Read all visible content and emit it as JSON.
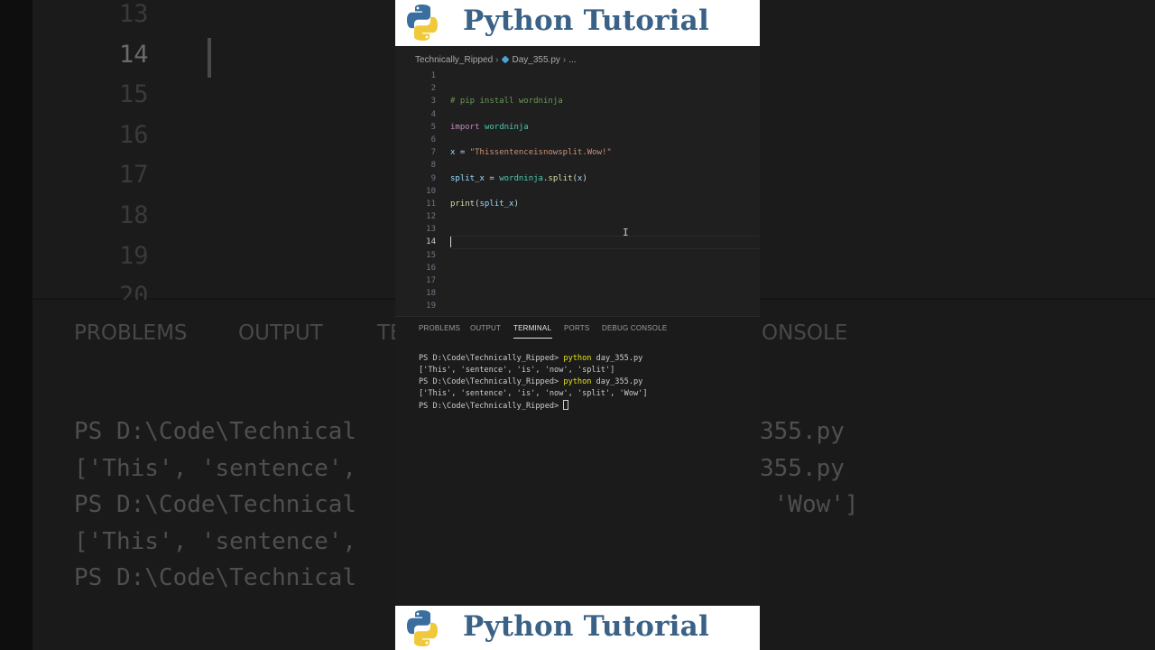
{
  "banner": {
    "title": "Python Tutorial",
    "logo_icon": "python-logo-icon",
    "title_color": "#3a6186"
  },
  "breadcrumb": {
    "folder": "Technically_Ripped",
    "file": "Day_355.py",
    "more": "..."
  },
  "editor": {
    "active_line": 14,
    "line_numbers": [
      "1",
      "2",
      "3",
      "4",
      "5",
      "6",
      "7",
      "8",
      "9",
      "10",
      "11",
      "12",
      "13",
      "14",
      "15",
      "16",
      "17",
      "18",
      "19"
    ],
    "code": {
      "line3": "# pip install wordninja",
      "line5_kw": "import",
      "line5_mod": "wordninja",
      "line7_var": "x",
      "line7_op": " = ",
      "line7_str": "\"Thissentenceisnowsplit.Wow!\"",
      "line9_var": "split_x",
      "line9_op": " = ",
      "line9_mod": "wordninja",
      "line9_dot": ".",
      "line9_fn": "split",
      "line9_args_open": "(",
      "line9_arg": "x",
      "line9_args_close": ")",
      "line11_fn": "print",
      "line11_open": "(",
      "line11_arg": "split_x",
      "line11_close": ")"
    }
  },
  "panel": {
    "tabs": [
      "PROBLEMS",
      "OUTPUT",
      "TERMINAL",
      "PORTS",
      "DEBUG CONSOLE"
    ],
    "active_tab": "TERMINAL",
    "terminal": {
      "prompt": "PS D:\\Code\\Technically_Ripped> ",
      "cmd": "python",
      "arg": " day_355.py",
      "out1": "['This', 'sentence', 'is', 'now', 'split']",
      "out2": "['This', 'sentence', 'is', 'now', 'split', 'Wow']"
    }
  },
  "background": {
    "line_numbers": [
      "13",
      "14",
      "15",
      "16",
      "17",
      "18",
      "19",
      "20"
    ],
    "tabs": [
      "PROBLEMS",
      "OUTPUT",
      "TE",
      "ONSOLE"
    ],
    "term_left": [
      "PS D:\\Code\\Technical",
      "['This', 'sentence',",
      "PS D:\\Code\\Technical",
      "['This', 'sentence',",
      "PS D:\\Code\\Technical"
    ],
    "term_right": [
      "355.py",
      "",
      "355.py",
      " 'Wow']",
      ""
    ]
  }
}
